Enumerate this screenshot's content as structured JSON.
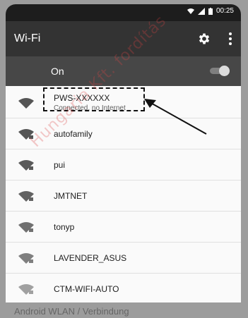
{
  "status_bar": {
    "time": "00:25"
  },
  "app_bar": {
    "title": "Wi-Fi"
  },
  "wifi_toggle": {
    "label": "On",
    "enabled": true
  },
  "networks": [
    {
      "name": "PWS-XXXXXX",
      "status": "Connected, no Internet"
    },
    {
      "name": "autofamily"
    },
    {
      "name": "pui"
    },
    {
      "name": "JMTNET"
    },
    {
      "name": "tonyp"
    },
    {
      "name": "LAVENDER_ASUS"
    },
    {
      "name": "CTM-WIFI-AUTO"
    }
  ],
  "watermark": "Hungaria Kft. fordítás",
  "caption": "Android WLAN / Verbindung"
}
